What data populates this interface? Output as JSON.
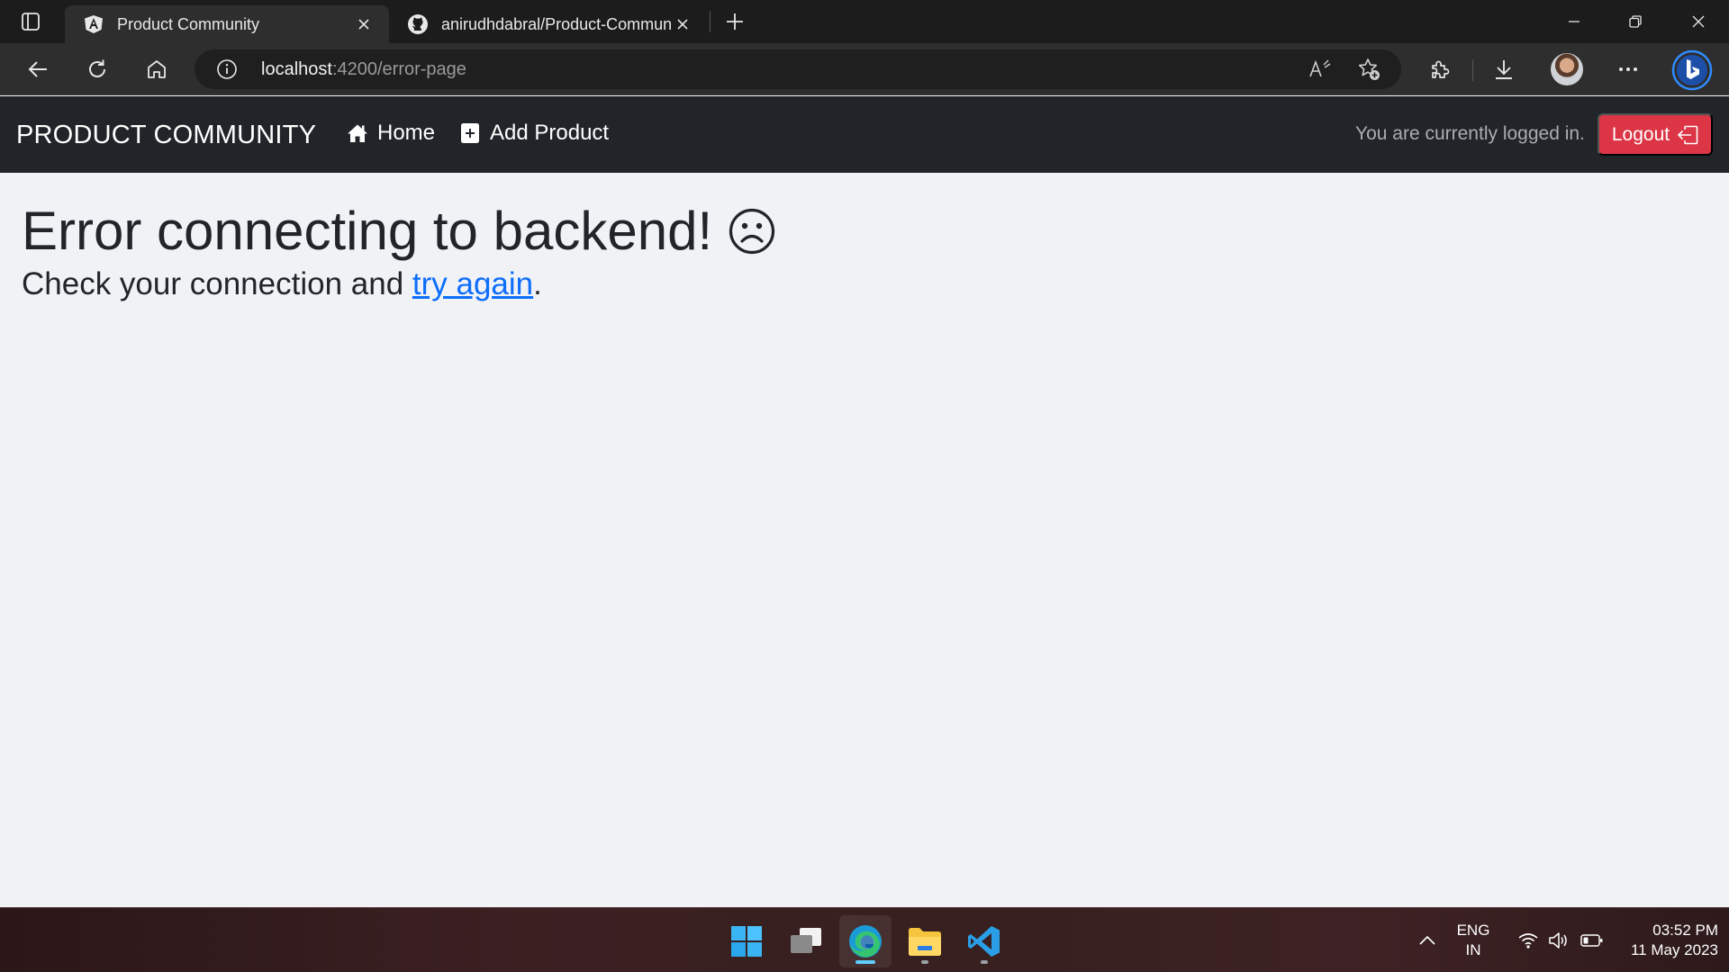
{
  "browser": {
    "tabs": [
      {
        "title": "Product Community",
        "favicon": "angular-icon",
        "active": true
      },
      {
        "title": "anirudhdabral/Product-Community",
        "favicon": "github-icon",
        "active": false
      }
    ],
    "url_host": "localhost",
    "url_rest": ":4200/error-page"
  },
  "navbar": {
    "brand": "PRODUCT COMMUNITY",
    "links": [
      {
        "label": "Home",
        "icon": "house-icon"
      },
      {
        "label": "Add Product",
        "icon": "plus-square-icon"
      }
    ],
    "status_text": "You are currently logged in.",
    "logout_label": "Logout",
    "logout_color": "#dc3545",
    "background": "#212529"
  },
  "content": {
    "title": "Error connecting to backend!",
    "subtitle_prefix": "Check your connection and ",
    "link_text": "try again",
    "subtitle_suffix": ".",
    "link_color": "#0d6efd"
  },
  "taskbar": {
    "apps": [
      "windows-start-icon",
      "task-view-icon",
      "edge-icon",
      "file-explorer-icon",
      "vscode-icon"
    ],
    "language": "ENG",
    "region": "IN",
    "time": "03:52 PM",
    "date": "11 May 2023"
  }
}
